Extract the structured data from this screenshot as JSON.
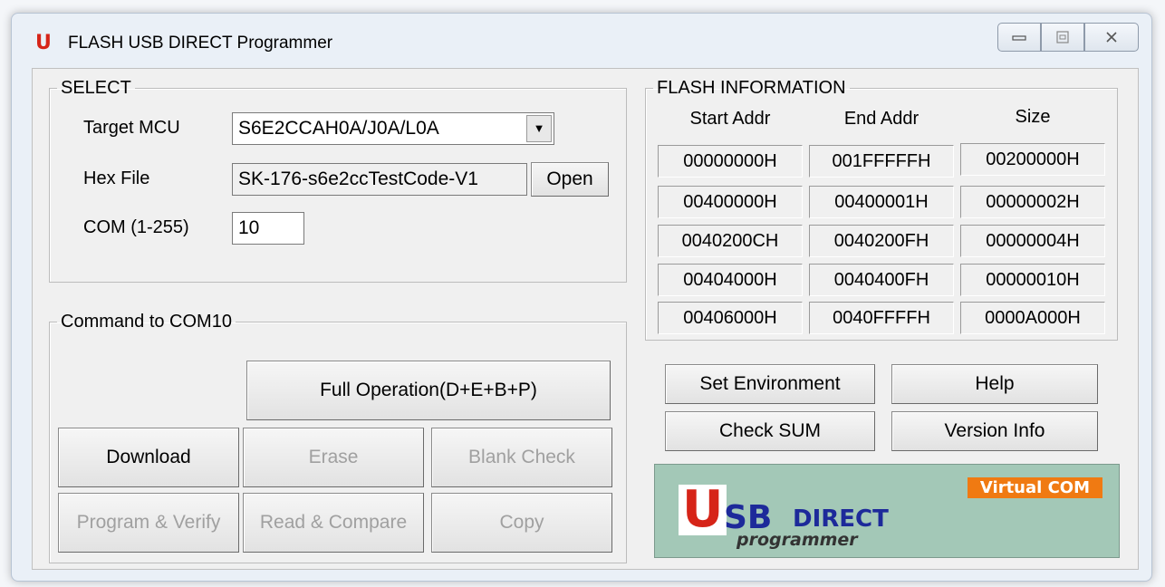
{
  "window": {
    "title": "FLASH USB DIRECT Programmer",
    "icon": "U",
    "controls": [
      "minimize-icon",
      "maximize-icon",
      "close-icon"
    ]
  },
  "select": {
    "legend": "SELECT",
    "target_mcu_label": "Target MCU",
    "target_mcu_value": "S6E2CCAH0A/J0A/L0A",
    "hex_file_label": "Hex File",
    "hex_file_value": "SK-176-s6e2ccTestCode-V1",
    "open_label": "Open",
    "com_label": "COM (1-255)",
    "com_value": "10"
  },
  "flash_info": {
    "legend": "FLASH INFORMATION",
    "headers": [
      "Start Addr",
      "End Addr",
      "Size"
    ],
    "rows": [
      [
        "00000000H",
        "001FFFFFH",
        "00200000H"
      ],
      [
        "00400000H",
        "00400001H",
        "00000002H"
      ],
      [
        "0040200CH",
        "0040200FH",
        "00000004H"
      ],
      [
        "00404000H",
        "0040400FH",
        "00000010H"
      ],
      [
        "00406000H",
        "0040FFFFH",
        "0000A000H"
      ]
    ]
  },
  "command": {
    "legend": "Command  to  COM10",
    "full_operation": "Full Operation(D+E+B+P)",
    "download": "Download",
    "erase": "Erase",
    "blank_check": "Blank Check",
    "program_verify": "Program & Verify",
    "read_compare": "Read & Compare",
    "copy": "Copy"
  },
  "side_buttons": {
    "set_environment": "Set Environment",
    "help": "Help",
    "check_sum": "Check SUM",
    "version_info": "Version Info"
  },
  "logo": {
    "virtual_com": "Virtual COM",
    "u": "U",
    "sb": "SB",
    "direct": "DIRECT",
    "programmer": "programmer"
  },
  "colors": {
    "brand_red": "#d62418",
    "logo_bg": "#a3c8b7",
    "logo_blue": "#1d2a9a",
    "badge_orange": "#f07a12"
  }
}
